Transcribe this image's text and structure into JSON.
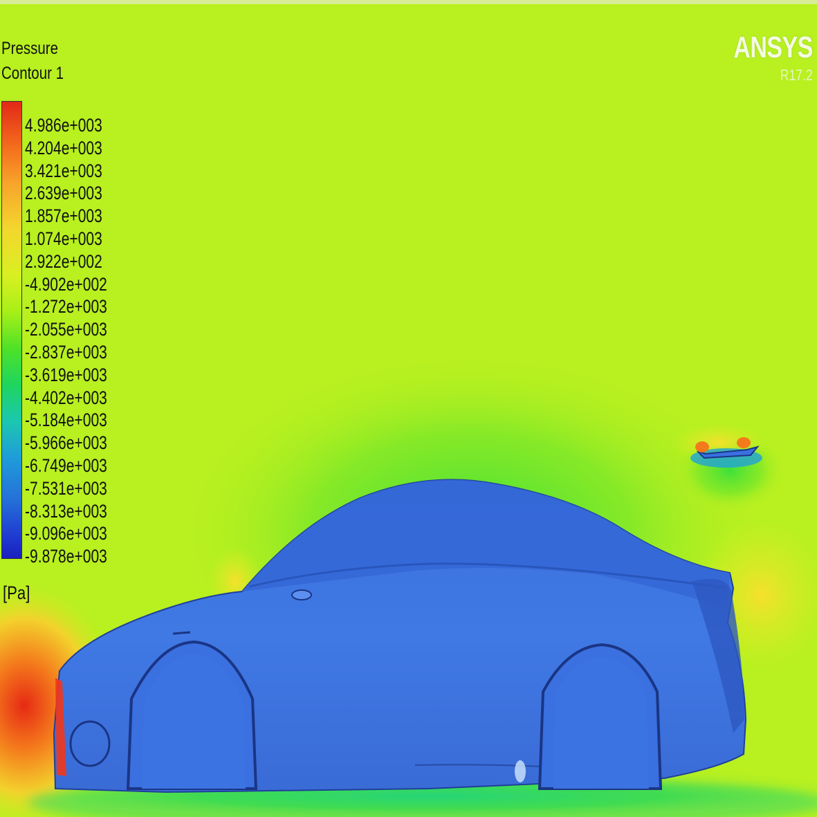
{
  "legend": {
    "title": "Pressure",
    "subtitle": "Contour 1",
    "unit": "[Pa]",
    "levels": [
      "4.986e+003",
      "4.204e+003",
      "3.421e+003",
      "2.639e+003",
      "1.857e+003",
      "1.074e+003",
      "2.922e+002",
      "-4.902e+002",
      "-1.272e+003",
      "-2.055e+003",
      "-2.837e+003",
      "-3.619e+003",
      "-4.402e+003",
      "-5.184e+003",
      "-5.966e+003",
      "-6.749e+003",
      "-7.531e+003",
      "-8.313e+003",
      "-9.096e+003",
      "-9.878e+003"
    ],
    "colors": [
      "#e22818",
      "#f7a52b",
      "#d8f021",
      "#1fd55e",
      "#1f9cd9",
      "#1a1fbf"
    ]
  },
  "branding": {
    "name": "ANSYS",
    "version": "R17.2"
  },
  "field": {
    "background_color": "#b8f020",
    "body_color": "#3f74e0"
  }
}
